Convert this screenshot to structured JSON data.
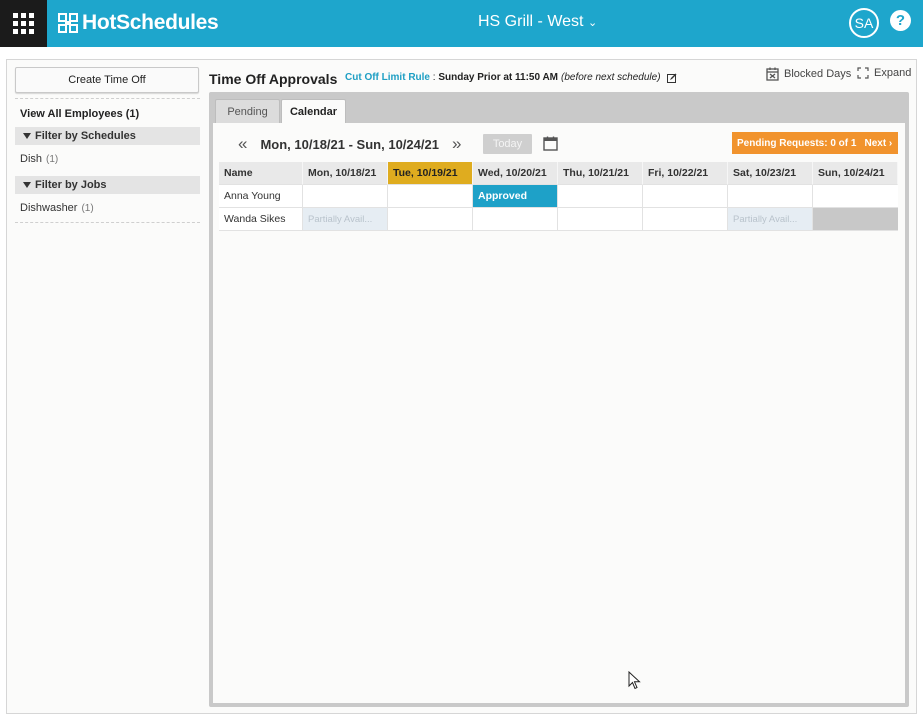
{
  "app": {
    "logo_text": "HotSchedules",
    "store_name": "HS Grill - West",
    "store_caret": "⌄",
    "user_initials": "SA",
    "help_label": "?"
  },
  "sidebar": {
    "create_button": "Create Time Off",
    "view_all": "View All Employees (1)",
    "filters": [
      {
        "title": "Filter by Schedules",
        "items": [
          {
            "label": "Dish",
            "count": "(1)"
          }
        ]
      },
      {
        "title": "Filter by Jobs",
        "items": [
          {
            "label": "Dishwasher",
            "count": "(1)"
          }
        ]
      }
    ]
  },
  "header": {
    "title": "Time Off Approvals",
    "cutoff_link": "Cut Off Limit Rule",
    "cutoff_sep": " : ",
    "cutoff_value": "Sunday Prior at 11:50 AM",
    "cutoff_note": "(before next schedule)",
    "blocked_days": "Blocked Days",
    "expand": "Expand"
  },
  "tabs": [
    {
      "label": "Pending",
      "active": false
    },
    {
      "label": "Calendar",
      "active": true
    }
  ],
  "calendar": {
    "prev": "«",
    "next": "»",
    "range": "Mon, 10/18/21 - Sun, 10/24/21",
    "today_button": "Today",
    "pending_requests": "Pending Requests: 0 of 1",
    "next_label": "Next ›",
    "columns": [
      "Name",
      "Mon, 10/18/21",
      "Tue, 10/19/21",
      "Wed, 10/20/21",
      "Thu, 10/21/21",
      "Fri, 10/22/21",
      "Sat, 10/23/21",
      "Sun, 10/24/21"
    ],
    "today_column": "Tue, 10/19/21",
    "rows": [
      {
        "name": "Anna Young",
        "cells": [
          "",
          "",
          "Approved",
          "",
          "",
          "",
          ""
        ]
      },
      {
        "name": "Wanda Sikes",
        "cells": [
          "Partially Avail...",
          "",
          "",
          "",
          "",
          "Partially Avail...",
          ""
        ]
      }
    ]
  },
  "colors": {
    "topbar": "#1ea6cc",
    "today_header": "#dfac1f",
    "approved": "#1ea1c8",
    "pending_badge": "#f1932d"
  }
}
